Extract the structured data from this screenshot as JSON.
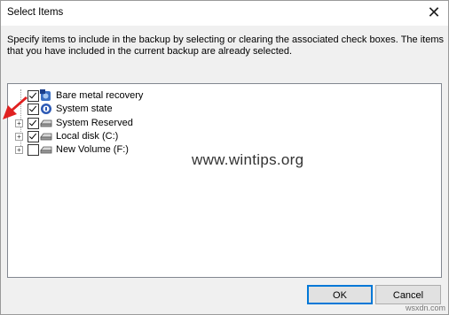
{
  "window": {
    "title": "Select Items",
    "close_glyph": "✕"
  },
  "instructions": "Specify items to include in the backup by selecting or clearing the associated check boxes. The items that you have included in the current backup are already selected.",
  "tree": {
    "items": [
      {
        "label": "Bare metal recovery",
        "checked": true,
        "expander": "",
        "icon": "recovery-icon"
      },
      {
        "label": "System state",
        "checked": true,
        "expander": "",
        "icon": "system-state-icon"
      },
      {
        "label": "System Reserved",
        "checked": true,
        "expander": "+",
        "icon": "drive-icon"
      },
      {
        "label": "Local disk (C:)",
        "checked": true,
        "expander": "+",
        "icon": "drive-icon"
      },
      {
        "label": "New Volume (F:)",
        "checked": false,
        "expander": "+",
        "icon": "drive-icon"
      }
    ]
  },
  "watermark": "www.wintips.org",
  "buttons": {
    "ok": "OK",
    "cancel": "Cancel"
  },
  "site_credit": "wsxdn.com",
  "colors": {
    "arrow": "#e02020",
    "accent": "#0078d7"
  }
}
